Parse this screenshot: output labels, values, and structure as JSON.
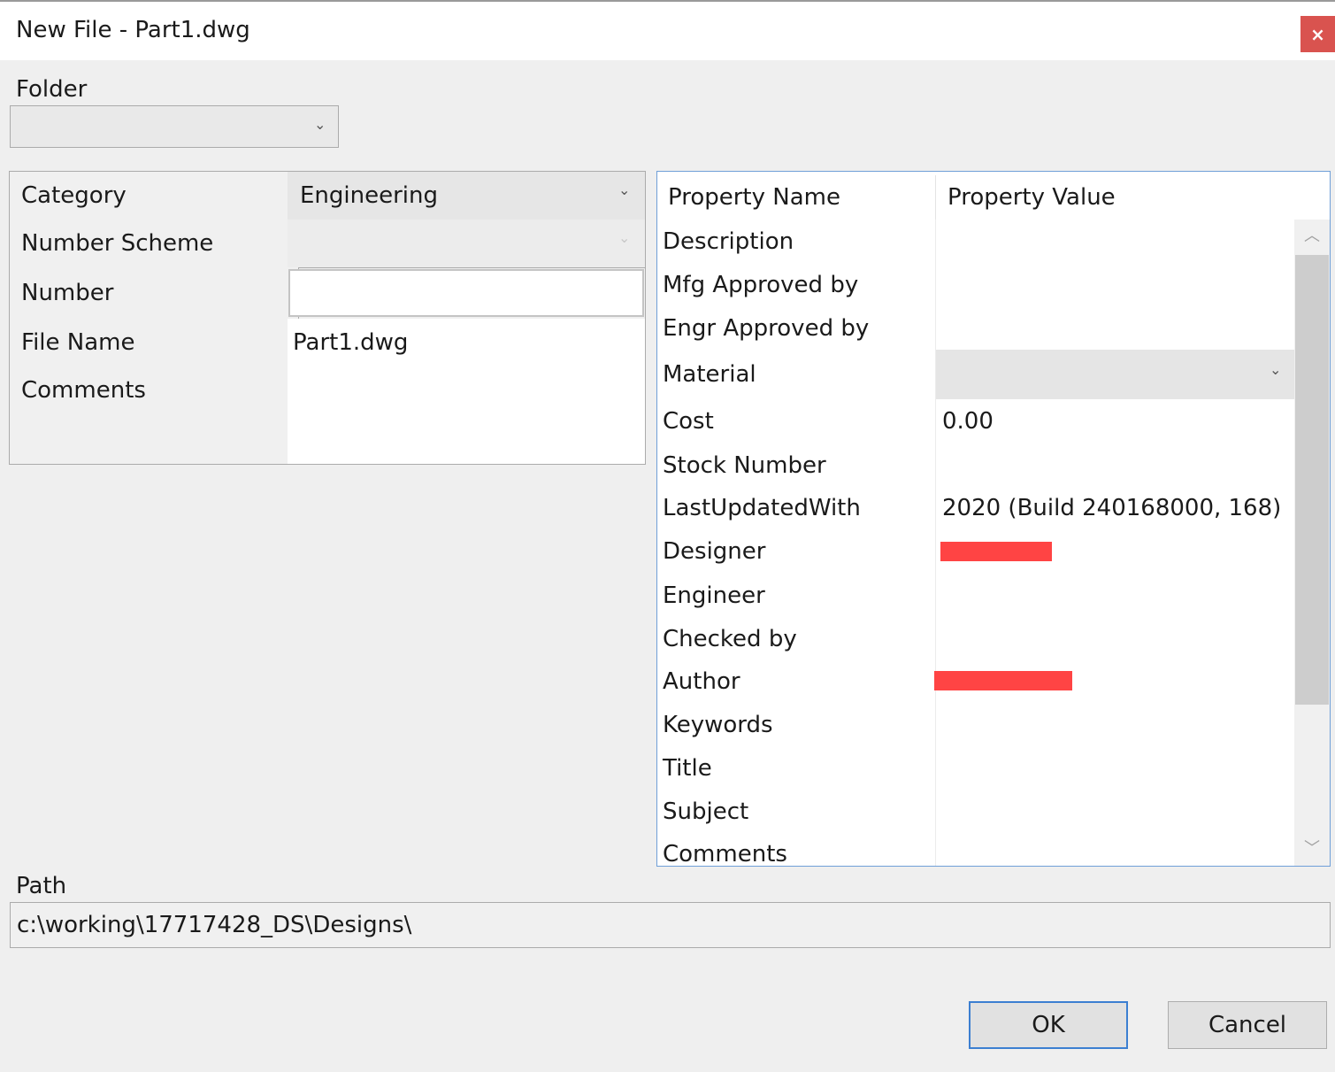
{
  "window": {
    "title": "New File - Part1.dwg",
    "close_glyph": "×"
  },
  "folder": {
    "label": "Folder",
    "value": ""
  },
  "left_grid": {
    "rows": [
      {
        "name": "Category",
        "value": "Engineering",
        "type": "dropdown"
      },
      {
        "name": "Number Scheme",
        "value": "",
        "type": "dropdown-disabled"
      },
      {
        "name": "Number",
        "value": "",
        "type": "input"
      },
      {
        "name": "File Name",
        "value": "Part1.dwg",
        "type": "text"
      },
      {
        "name": "Comments",
        "value": "",
        "type": "textarea"
      }
    ]
  },
  "property_grid": {
    "header_name": "Property Name",
    "header_value": "Property Value",
    "rows": [
      {
        "name": "Description",
        "value": ""
      },
      {
        "name": "Mfg Approved by",
        "value": ""
      },
      {
        "name": "Engr Approved by",
        "value": ""
      },
      {
        "name": "Material",
        "value": ""
      },
      {
        "name": "Cost",
        "value": "0.00"
      },
      {
        "name": "Stock Number",
        "value": ""
      },
      {
        "name": "LastUpdatedWith",
        "value": "2020 (Build 240168000, 168)"
      },
      {
        "name": "Designer",
        "value": ""
      },
      {
        "name": "Engineer",
        "value": ""
      },
      {
        "name": "Checked by",
        "value": ""
      },
      {
        "name": "Author",
        "value": ""
      },
      {
        "name": "Keywords",
        "value": ""
      },
      {
        "name": "Title",
        "value": ""
      },
      {
        "name": "Subject",
        "value": ""
      },
      {
        "name": "Comments",
        "value": ""
      }
    ]
  },
  "path": {
    "label": "Path",
    "value": "c:\\working\\17717428_DS\\Designs\\"
  },
  "buttons": {
    "ok": "OK",
    "cancel": "Cancel"
  },
  "colors": {
    "redaction": "#ff4444",
    "focus_border": "#3c7fd1",
    "close_button": "#d9534f"
  },
  "icons": {
    "dropdown": "chevron-down-icon",
    "scroll_up": "chevron-up-icon",
    "scroll_down": "chevron-down-icon",
    "close": "close-icon"
  }
}
